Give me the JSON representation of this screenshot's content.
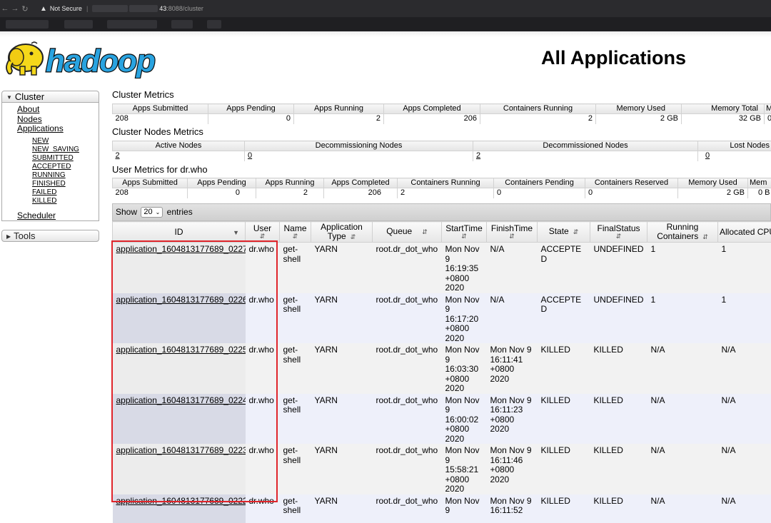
{
  "browser": {
    "security_label": "Not Secure",
    "host_suffix": "43",
    "path": ":8088/cluster"
  },
  "header": {
    "logo_text": "hadoop",
    "title": "All Applications"
  },
  "sidebar": {
    "cluster_label": "Cluster",
    "links": [
      "About",
      "Nodes",
      "Applications"
    ],
    "states": [
      "NEW",
      "NEW_SAVING",
      "SUBMITTED",
      "ACCEPTED",
      "RUNNING",
      "FINISHED",
      "FAILED",
      "KILLED"
    ],
    "scheduler_label": "Scheduler",
    "tools_label": "Tools"
  },
  "cluster_metrics": {
    "title": "Cluster Metrics",
    "headers": [
      "Apps Submitted",
      "Apps Pending",
      "Apps Running",
      "Apps Completed",
      "Containers Running",
      "Memory Used",
      "Memory Total",
      "M"
    ],
    "values": [
      "208",
      "0",
      "2",
      "206",
      "2",
      "2 GB",
      "32 GB",
      "0"
    ]
  },
  "node_metrics": {
    "title": "Cluster Nodes Metrics",
    "headers": [
      "Active Nodes",
      "Decommissioning Nodes",
      "Decommissioned Nodes",
      "Lost Nodes"
    ],
    "values": [
      "2",
      "0",
      "2",
      "0"
    ]
  },
  "user_metrics": {
    "title": "User Metrics for dr.who",
    "headers": [
      "Apps Submitted",
      "Apps Pending",
      "Apps Running",
      "Apps Completed",
      "Containers Running",
      "Containers Pending",
      "Containers Reserved",
      "Memory Used",
      "Mem"
    ],
    "values": [
      "208",
      "0",
      "2",
      "206",
      "2",
      "0",
      "0",
      "2 GB",
      "0 B"
    ]
  },
  "entries": {
    "show_label": "Show",
    "page_size": "20",
    "entries_label": "entries"
  },
  "apps_table": {
    "columns": [
      "ID",
      "User",
      "Name",
      "Application Type",
      "Queue",
      "StartTime",
      "FinishTime",
      "State",
      "FinalStatus",
      "Running Containers",
      "Allocated CPU VCores"
    ],
    "rows": [
      {
        "id": "application_1604813177689_0227",
        "user": "dr.who",
        "name": "get-shell",
        "type": "YARN",
        "queue": "root.dr_dot_who",
        "start": "Mon Nov 9 16:19:35 +0800 2020",
        "finish": "N/A",
        "state": "ACCEPTED",
        "final": "UNDEFINED",
        "running": "1",
        "vcores": "1"
      },
      {
        "id": "application_1604813177689_0226",
        "user": "dr.who",
        "name": "get-shell",
        "type": "YARN",
        "queue": "root.dr_dot_who",
        "start": "Mon Nov 9 16:17:20 +0800 2020",
        "finish": "N/A",
        "state": "ACCEPTED",
        "final": "UNDEFINED",
        "running": "1",
        "vcores": "1"
      },
      {
        "id": "application_1604813177689_0225",
        "user": "dr.who",
        "name": "get-shell",
        "type": "YARN",
        "queue": "root.dr_dot_who",
        "start": "Mon Nov 9 16:03:30 +0800 2020",
        "finish": "Mon Nov 9 16:11:41 +0800 2020",
        "state": "KILLED",
        "final": "KILLED",
        "running": "N/A",
        "vcores": "N/A"
      },
      {
        "id": "application_1604813177689_0224",
        "user": "dr.who",
        "name": "get-shell",
        "type": "YARN",
        "queue": "root.dr_dot_who",
        "start": "Mon Nov 9 16:00:02 +0800 2020",
        "finish": "Mon Nov 9 16:11:23 +0800 2020",
        "state": "KILLED",
        "final": "KILLED",
        "running": "N/A",
        "vcores": "N/A"
      },
      {
        "id": "application_1604813177689_0223",
        "user": "dr.who",
        "name": "get-shell",
        "type": "YARN",
        "queue": "root.dr_dot_who",
        "start": "Mon Nov 9 15:58:21 +0800 2020",
        "finish": "Mon Nov 9 16:11:46 +0800 2020",
        "state": "KILLED",
        "final": "KILLED",
        "running": "N/A",
        "vcores": "N/A"
      },
      {
        "id": "application_1604813177689_0222",
        "user": "dr.who",
        "name": "get-shell",
        "type": "YARN",
        "queue": "root.dr_dot_who",
        "start": "Mon Nov 9",
        "finish": "Mon Nov 9 16:11:52",
        "state": "KILLED",
        "final": "KILLED",
        "running": "N/A",
        "vcores": "N/A"
      }
    ]
  },
  "colors": {
    "highlight": "#e0252b",
    "logo_blue": "#29a3e0",
    "elephant_yellow": "#f5d81a"
  }
}
